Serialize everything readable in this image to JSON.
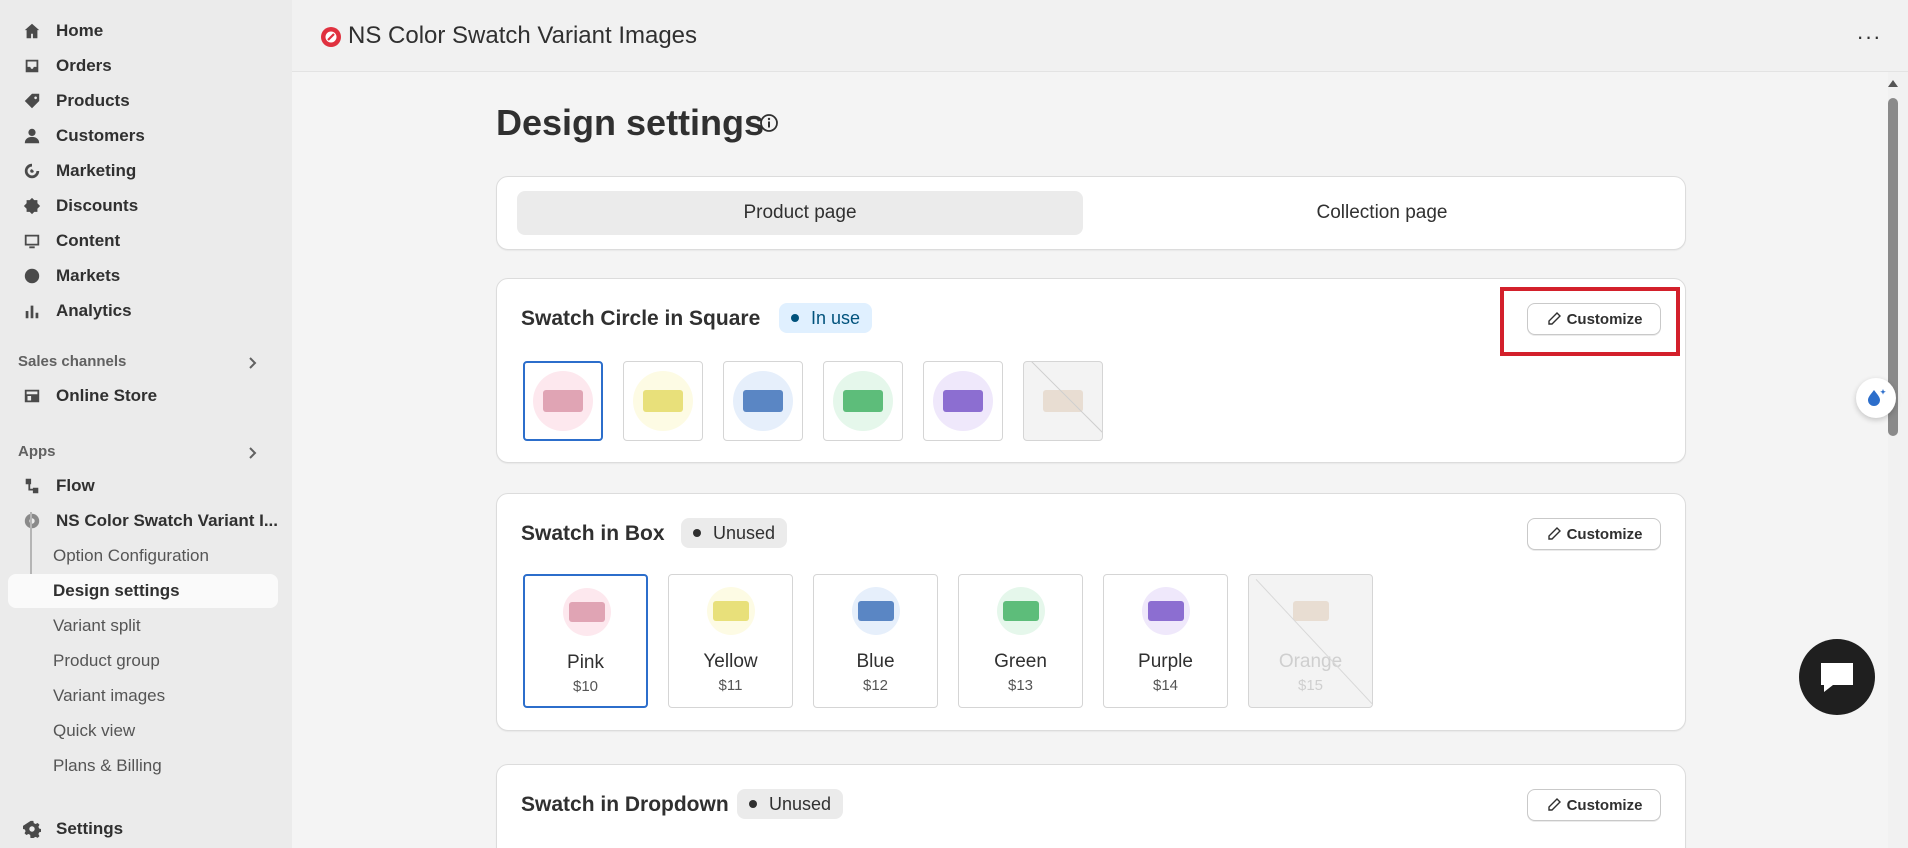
{
  "sidebar": {
    "items": [
      {
        "label": "Home",
        "icon": "home-icon"
      },
      {
        "label": "Orders",
        "icon": "inbox-icon"
      },
      {
        "label": "Products",
        "icon": "tag-icon"
      },
      {
        "label": "Customers",
        "icon": "person-icon"
      },
      {
        "label": "Marketing",
        "icon": "target-icon"
      },
      {
        "label": "Discounts",
        "icon": "discount-icon"
      },
      {
        "label": "Content",
        "icon": "image-icon"
      },
      {
        "label": "Markets",
        "icon": "globe-icon"
      },
      {
        "label": "Analytics",
        "icon": "bar-chart-icon"
      }
    ],
    "sales_channels_label": "Sales channels",
    "online_store_label": "Online Store",
    "apps_label": "Apps",
    "flow_label": "Flow",
    "app_label": "NS Color Swatch Variant I...",
    "sub_items": [
      "Option Configuration",
      "Design settings",
      "Variant split",
      "Product group",
      "Variant images",
      "Quick view",
      "Plans & Billing"
    ],
    "settings_label": "Settings"
  },
  "appbar": {
    "title": "NS Color Swatch Variant Images",
    "more_label": "···"
  },
  "main": {
    "page_title": "Design settings",
    "tabs": [
      {
        "label": "Product page",
        "active": true
      },
      {
        "label": "Collection page",
        "active": false
      }
    ],
    "cards": [
      {
        "title": "Swatch Circle in Square",
        "status": "In use",
        "customize": "Customize"
      },
      {
        "title": "Swatch in Box",
        "status": "Unused",
        "customize": "Customize"
      },
      {
        "title": "Swatch in Dropdown",
        "status": "Unused",
        "customize": "Customize"
      }
    ],
    "box_swatches": [
      {
        "name": "Pink",
        "price": "$10"
      },
      {
        "name": "Yellow",
        "price": "$11"
      },
      {
        "name": "Blue",
        "price": "$12"
      },
      {
        "name": "Green",
        "price": "$13"
      },
      {
        "name": "Purple",
        "price": "$14"
      },
      {
        "name": "Orange",
        "price": "$15"
      }
    ]
  },
  "colors": {
    "accent": "#2c6ecb",
    "highlight": "#d3202b",
    "pink": "#e0a4b4",
    "yellow": "#e8e07a",
    "blue": "#5a86c4",
    "green": "#5dbd7a",
    "purple": "#8c6ed1",
    "orange": "#e8ddd2"
  }
}
